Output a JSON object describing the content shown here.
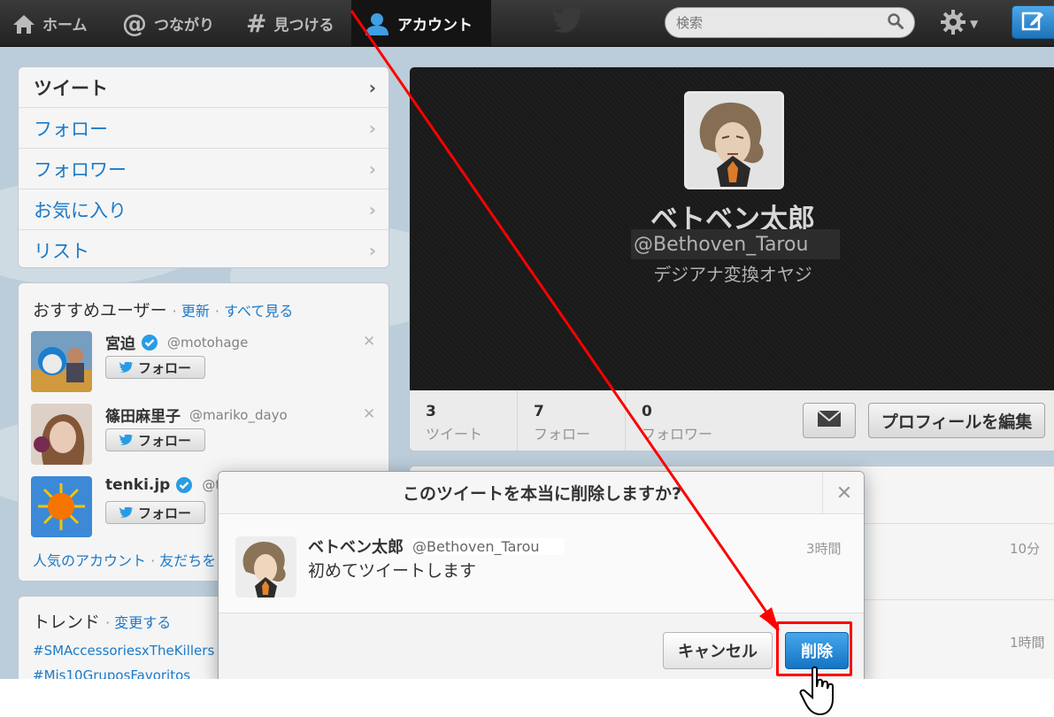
{
  "nav": {
    "items": [
      {
        "label": "ホーム",
        "icon": "home-icon"
      },
      {
        "label": "つながり",
        "icon": "at-icon"
      },
      {
        "label": "見つける",
        "icon": "hashtag-icon"
      },
      {
        "label": "アカウント",
        "icon": "person-icon"
      }
    ],
    "search_placeholder": "検索"
  },
  "sidebar": {
    "menu": [
      {
        "label": "ツイート",
        "selected": true
      },
      {
        "label": "フォロー"
      },
      {
        "label": "フォロワー"
      },
      {
        "label": "お気に入り"
      },
      {
        "label": "リスト"
      }
    ],
    "recommend": {
      "title": "おすすめユーザー",
      "refresh": "更新",
      "see_all": "すべて見る",
      "follow_label": "フォロー",
      "users": [
        {
          "name": "宮迫",
          "handle": "@motohage",
          "verified": true
        },
        {
          "name": "篠田麻里子",
          "handle": "@mariko_dayo",
          "verified": false
        },
        {
          "name": "tenki.jp",
          "handle": "@t",
          "verified": true
        }
      ],
      "footer_popular": "人気のアカウント",
      "footer_friends": "友だちを"
    },
    "trends": {
      "title": "トレンド",
      "change": "変更する",
      "items": [
        "#SMAccessoriesxTheKillers",
        "#Mis10GruposFavoritos"
      ]
    }
  },
  "profile": {
    "name": "ベトベン太郎",
    "handle": "@Bethoven_Tarou",
    "bio": "デジアナ変換オヤジ",
    "stats": [
      {
        "num": "3",
        "label": "ツイート"
      },
      {
        "num": "7",
        "label": "フォロー"
      },
      {
        "num": "0",
        "label": "フォロワー"
      }
    ],
    "edit_label": "プロフィールを編集"
  },
  "timeline": {
    "times": [
      "10分",
      "1時間"
    ]
  },
  "modal": {
    "title": "このツイートを本当に削除しますか?",
    "tweet_name": "ベトベン太郎",
    "tweet_handle": "@Bethoven_Tarou",
    "tweet_text": "初めてツイートします",
    "tweet_time": "3時間",
    "cancel_label": "キャンセル",
    "delete_label": "削除"
  },
  "colors": {
    "accent_link": "#1f7fd1",
    "delete_button": "#1674c4",
    "annotation_red": "#ff0000"
  }
}
